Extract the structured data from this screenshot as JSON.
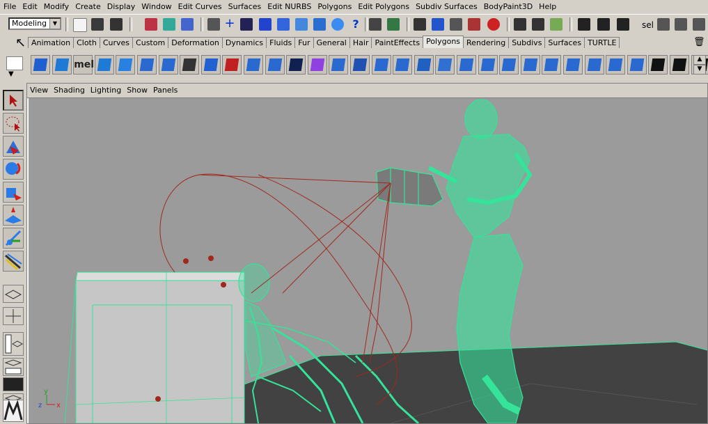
{
  "menubar": [
    "File",
    "Edit",
    "Modify",
    "Create",
    "Display",
    "Window",
    "Edit Curves",
    "Surfaces",
    "Edit NURBS",
    "Polygons",
    "Edit Polygons",
    "Subdiv Surfaces",
    "BodyPaint3D",
    "Help"
  ],
  "status": {
    "mode": "Modeling",
    "sel_label": "sel"
  },
  "shelf_tabs": [
    "Animation",
    "Cloth",
    "Curves",
    "Custom",
    "Deformation",
    "Dynamics",
    "Fluids",
    "Fur",
    "General",
    "Hair",
    "PaintEffects",
    "Polygons",
    "Rendering",
    "Subdivs",
    "Surfaces",
    "TURTLE"
  ],
  "active_tab": "Polygons",
  "shelf_mel_label": "mel",
  "panel_menu": [
    "View",
    "Shading",
    "Lighting",
    "Show",
    "Panels"
  ],
  "axis": {
    "x": "x",
    "y": "y",
    "z": "z"
  },
  "colors": {
    "ui_gray": "#d4d0c8",
    "viewport_gray": "#9b9b9b",
    "wire_green": "#35e39a",
    "floor_dark": "#424242",
    "curve_red": "#a0281c"
  }
}
